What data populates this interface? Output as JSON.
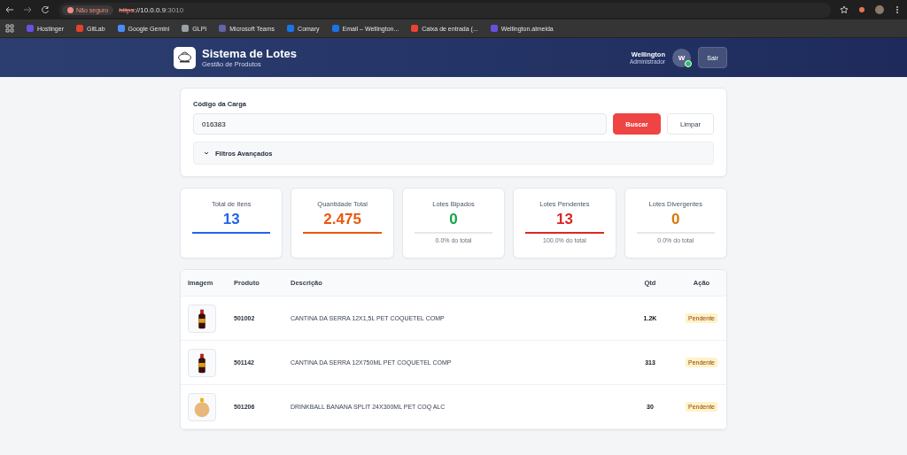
{
  "browser": {
    "security_label": "Não seguro",
    "url_scheme": "https",
    "url_host": "://10.0.0.9",
    "url_port": ":3010"
  },
  "bookmarks": [
    {
      "label": "Hostinger",
      "color": "#6b4fe0"
    },
    {
      "label": "GitLab",
      "color": "#e2432a"
    },
    {
      "label": "Google Gemini",
      "color": "#4b8df8"
    },
    {
      "label": "GLPI",
      "color": "#9aa0a6"
    },
    {
      "label": "Microsoft Teams",
      "color": "#6264a7"
    },
    {
      "label": "Comary",
      "color": "#1a73e8"
    },
    {
      "label": "Email – Wellington...",
      "color": "#1a73e8"
    },
    {
      "label": "Caixa de entrada (...",
      "color": "#ea4335"
    },
    {
      "label": "Wellington.almeida",
      "color": "#6b4fe0"
    }
  ],
  "header": {
    "title": "Sistema de Lotes",
    "subtitle": "Gestão de Produtos",
    "user_name": "Wellington",
    "user_role": "Administrador",
    "avatar_letter": "W",
    "online": true,
    "logout": "Sair"
  },
  "search": {
    "label": "Código da Carga",
    "value": "016383",
    "search_button": "Buscar",
    "clear_button": "Limpar",
    "filters": {
      "label": "Filtros Avançados",
      "expanded": false
    }
  },
  "stats": [
    {
      "label": "Total de Itens",
      "value": "13",
      "color": "#2563eb",
      "level": 1
    },
    {
      "label": "Quantidade Total",
      "value": "2.475",
      "color": "#ea580c",
      "level": 1
    },
    {
      "label": "Lotes Bipados",
      "value": "0",
      "color": "#16a34a",
      "level": 0,
      "note": "0.0% do total"
    },
    {
      "label": "Lotes Pendentes",
      "value": "13",
      "color": "#dc2626",
      "level": 1,
      "note": "100.0% do total"
    },
    {
      "label": "Lotes Divergentes",
      "value": "0",
      "color": "#d97706",
      "level": 0,
      "note": "0.0% do total"
    }
  ],
  "table": {
    "columns": [
      "Imagem",
      "Produto",
      "Descrição",
      "Qtd",
      "Ação"
    ],
    "rows": [
      {
        "product": "501002",
        "description": "CANTINA DA SERRA 12X1,5L PET COQUETEL COMP",
        "qty": "1.2K",
        "status": "Pendente",
        "kind": "bottle"
      },
      {
        "product": "501142",
        "description": "CANTINA DA SERRA 12X750ML PET COQUETEL COMP",
        "qty": "313",
        "status": "Pendente",
        "kind": "bottle"
      },
      {
        "product": "501206",
        "description": "DRINKBALL BANANA SPLIT 24X300ML PET COQ ALC",
        "qty": "30",
        "status": "Pendente",
        "kind": "ball"
      }
    ]
  }
}
